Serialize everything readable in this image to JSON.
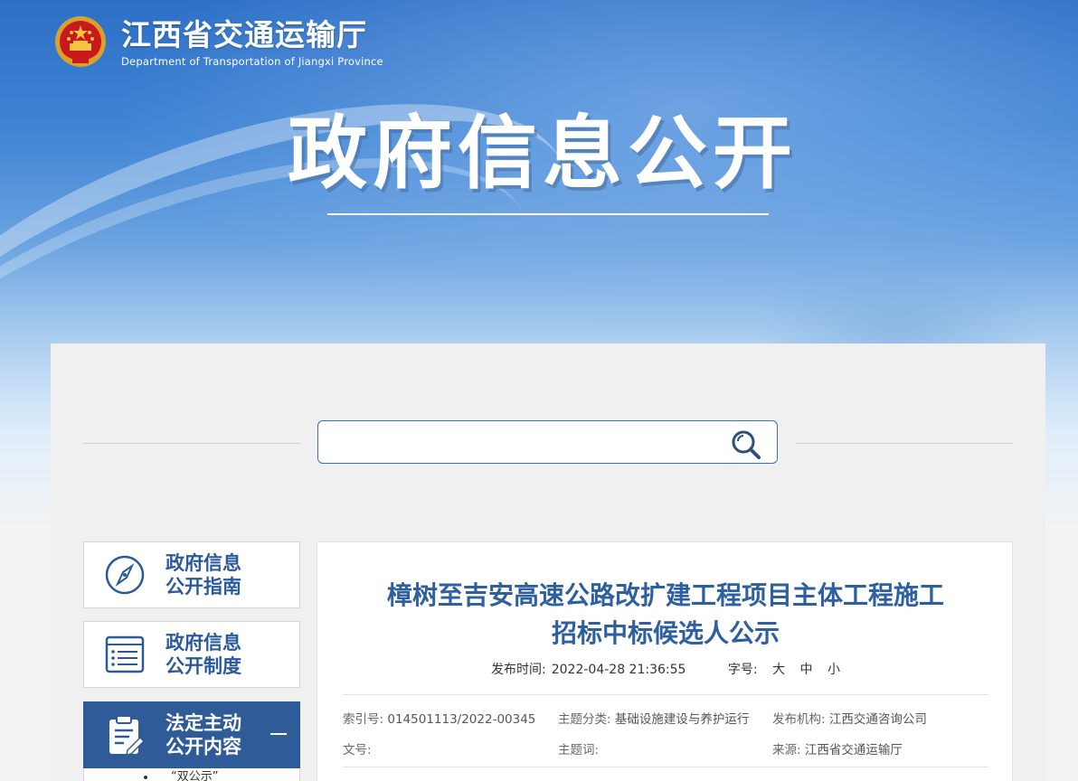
{
  "header": {
    "site_name_cn": "江西省交通运输厅",
    "site_name_en": "Department of Transportation of Jiangxi Province",
    "banner_title": "政府信息公开"
  },
  "search": {
    "placeholder": ""
  },
  "sidebar": {
    "items": [
      {
        "line1": "政府信息",
        "line2": "公开指南",
        "icon": "compass-icon"
      },
      {
        "line1": "政府信息",
        "line2": "公开制度",
        "icon": "list-icon"
      },
      {
        "line1": "法定主动",
        "line2": "公开内容",
        "icon": "clipboard-icon",
        "active": true
      }
    ],
    "sub_item": "“双公示”"
  },
  "article": {
    "title_line1": "樟树至吉安高速公路改扩建工程项目主体工程施工",
    "title_line2": "招标中标候选人公示",
    "publish_label": "发布时间:",
    "publish_time": "2022-04-28 21:36:55",
    "font_label": "字号:",
    "font_large": "大",
    "font_medium": "中",
    "font_small": "小",
    "index_label": "索引号:",
    "index_value": "014501113/2022-00345",
    "category_label": "主题分类:",
    "category_value": "基础设施建设与养护运行",
    "org_label": "发布机构:",
    "org_value": "江西交通咨询公司",
    "doc_label": "文号:",
    "doc_value": "",
    "keyword_label": "主题词:",
    "keyword_value": "",
    "source_label": "来源:",
    "source_value": "江西省交通运输厅"
  },
  "colors": {
    "brand_blue": "#2e5f9e",
    "active_bg": "#2f5c99"
  }
}
